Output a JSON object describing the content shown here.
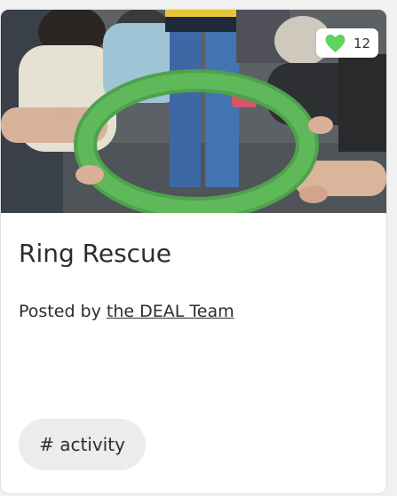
{
  "card": {
    "image_alt": "People kneeling around a green cardboard ring on the floor",
    "likes": {
      "count": "12",
      "icon": "heart-icon",
      "color": "#5fd35f"
    },
    "title": "Ring Rescue",
    "posted_prefix": "Posted by",
    "author": "the DEAL Team",
    "tag": "# activity"
  }
}
